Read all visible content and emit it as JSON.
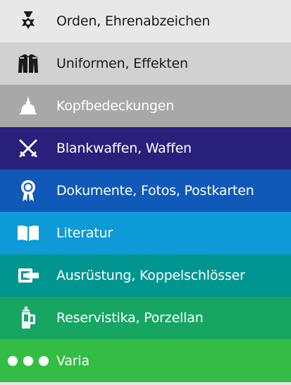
{
  "menu": {
    "items": [
      {
        "label": "Orden, Ehrenabzeichen",
        "icon": "medal-icon",
        "bg": "#e8e8e8",
        "fg": "#1a1a1a",
        "iconColor": "#1a1a1a"
      },
      {
        "label": "Uniformen, Effekten",
        "icon": "uniform-icon",
        "bg": "#d1d1d1",
        "fg": "#1a1a1a",
        "iconColor": "#1a1a1a"
      },
      {
        "label": "Kopfbedeckungen",
        "icon": "spiked-helmet-icon",
        "bg": "#a8a8a8",
        "fg": "#ffffff",
        "iconColor": "#ffffff"
      },
      {
        "label": "Blankwaffen, Waffen",
        "icon": "crossed-swords-icon",
        "bg": "#28207a",
        "fg": "#ffffff",
        "iconColor": "#ffffff"
      },
      {
        "label": "Dokumente, Fotos, Postkarten",
        "icon": "rosette-icon",
        "bg": "#1159b8",
        "fg": "#ffffff",
        "iconColor": "#ffffff"
      },
      {
        "label": "Literatur",
        "icon": "open-book-icon",
        "bg": "#0d9ad6",
        "fg": "#ffffff",
        "iconColor": "#ffffff"
      },
      {
        "label": "Ausrüstung, Koppelschlösser",
        "icon": "belt-buckle-icon",
        "bg": "#00968f",
        "fg": "#ffffff",
        "iconColor": "#ffffff"
      },
      {
        "label": "Reservistika, Porzellan",
        "icon": "beer-stein-icon",
        "bg": "#16a662",
        "fg": "#ffffff",
        "iconColor": "#ffffff"
      },
      {
        "label": "Varia",
        "icon": "three-dots-icon",
        "bg": "#33bd45",
        "fg": "#ffffff",
        "iconColor": "#ffffff"
      }
    ]
  }
}
